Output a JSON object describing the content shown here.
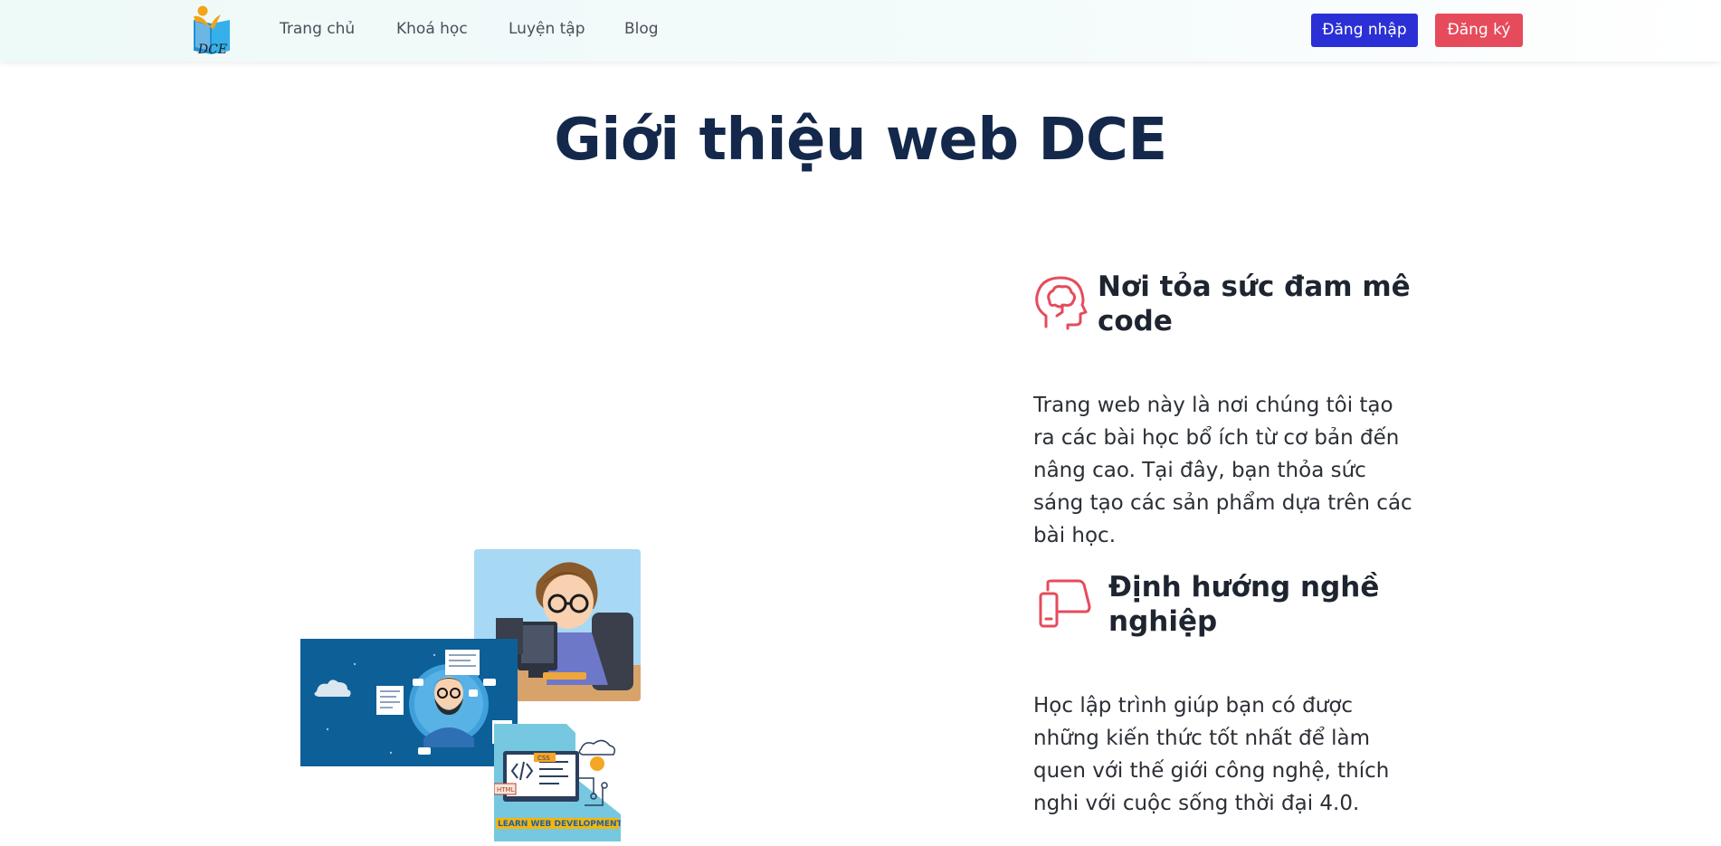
{
  "header": {
    "logo_text": "DCE",
    "nav": [
      {
        "label": "Trang chủ"
      },
      {
        "label": "Khoá học"
      },
      {
        "label": "Luyện tập"
      },
      {
        "label": "Blog"
      }
    ],
    "login_label": "Đăng nhập",
    "register_label": "Đăng ký",
    "login_color": "#2b2fd6",
    "register_color": "#e64b5c"
  },
  "main": {
    "title": "Giới thiệu web DCE",
    "features": [
      {
        "icon": "brain-head-icon",
        "title": "Nơi tỏa sức đam mê code",
        "description": "Trang web này là nơi chúng tôi tạo ra các bài học bổ ích từ cơ bản đến nâng cao. Tại đây, bạn thỏa sức sáng tạo các sản phẩm dựa trên các bài học."
      },
      {
        "icon": "devices-icon",
        "title": "Định hướng nghề nghiệp",
        "description": "Học lập trình giúp bạn có được những kiến thức tốt nhất để làm quen với thế giới công nghệ, thích nghi với cuộc sống thời đại 4.0."
      }
    ],
    "collage": {
      "image_3_caption": "LEARN WEB DEVELOPMENT"
    }
  },
  "accent_color": "#e64b5c",
  "title_color": "#14284b"
}
